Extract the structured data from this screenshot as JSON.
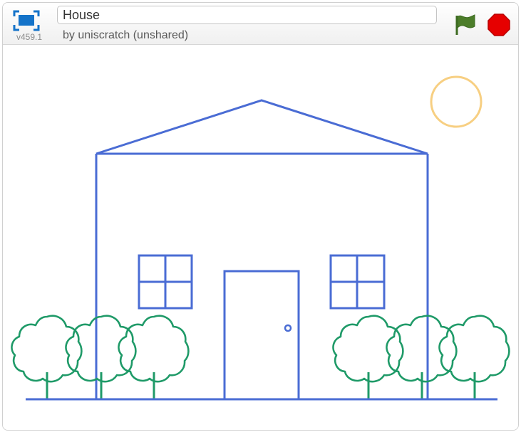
{
  "project": {
    "title": "House",
    "byline": "by uniscratch (unshared)",
    "version": "v459.1"
  },
  "controls": {
    "fullscreen_icon": "fullscreen-icon",
    "green_flag_icon": "green-flag-icon",
    "stop_icon": "stop-icon"
  },
  "colors": {
    "house_line": "#4a6cd4",
    "tree_line": "#1f9a68",
    "sun_line": "#f7cf82",
    "stop_red": "#e60000",
    "flag_green": "#4c7d2a",
    "fullscreen_blue": "#1473c9"
  }
}
